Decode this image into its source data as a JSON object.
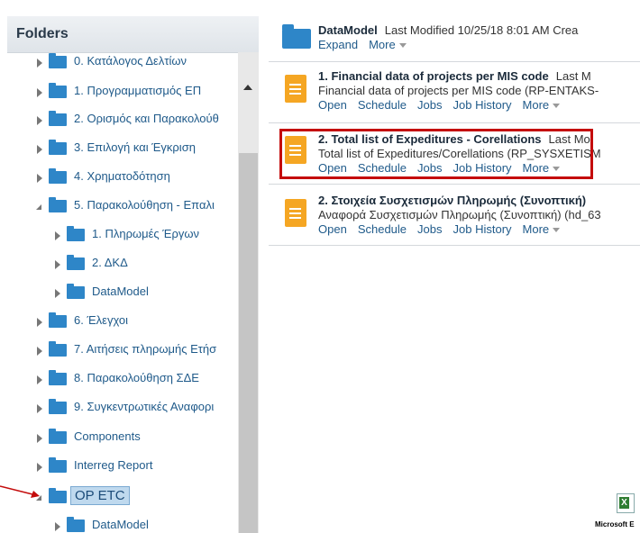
{
  "sidebar": {
    "header": "Folders",
    "items": [
      {
        "label": "0. Κατάλογος Δελτίων",
        "expanded": false
      },
      {
        "label": "1.  Προγραμματισμός ΕΠ",
        "expanded": false
      },
      {
        "label": "2. Ορισμός και Παρακολούθ",
        "expanded": false
      },
      {
        "label": "3. Επιλογή και Έγκριση",
        "expanded": false
      },
      {
        "label": "4. Χρηματοδότηση",
        "expanded": false
      },
      {
        "label": "5. Παρακολούθηση - Επαλι",
        "expanded": true
      },
      {
        "label": "1. Πληρωμές Έργων",
        "expanded": false
      },
      {
        "label": "2. ΔΚΔ",
        "expanded": false
      },
      {
        "label": "DataModel",
        "expanded": false
      },
      {
        "label": "6. Έλεγχοι",
        "expanded": false
      },
      {
        "label": "7. Αιτήσεις πληρωμής Ετήσ",
        "expanded": false
      },
      {
        "label": "8. Παρακολούθηση ΣΔΕ",
        "expanded": false
      },
      {
        "label": "9. Συγκεντρωτικές Αναφορι",
        "expanded": false
      },
      {
        "label": "Components",
        "expanded": false
      },
      {
        "label": "Interreg Report",
        "expanded": false
      },
      {
        "label": "OP ETC",
        "expanded": true
      },
      {
        "label": "DataModel",
        "expanded": false
      }
    ]
  },
  "main": {
    "folder_item": {
      "title": "DataModel",
      "meta": "Last Modified 10/25/18 8:01 AM   Crea",
      "actions": [
        "Expand",
        "More"
      ]
    },
    "items": [
      {
        "title": "1. Financial data of projects per MIS code",
        "meta": "Last M",
        "desc": "Financial data of projects per MIS code (RP-ENTAKS-",
        "actions": [
          "Open",
          "Schedule",
          "Jobs",
          "Job History",
          "More"
        ]
      },
      {
        "title": "2. Total list of Expeditures - Corellations",
        "meta": "Last Mo",
        "desc": "Total list of Expeditures/Corellations (RP_SYSXETISM",
        "actions": [
          "Open",
          "Schedule",
          "Jobs",
          "Job History",
          "More"
        ]
      },
      {
        "title": "2. Στοιχεία Συσχετισμών Πληρωμής (Συνοπτική)",
        "meta": "",
        "desc": "Αναφορά Συσχετισμών Πληρωμής (Συνοπτική) (hd_63",
        "actions": [
          "Open",
          "Schedule",
          "Jobs",
          "Job History",
          "More"
        ]
      }
    ]
  },
  "desktop": {
    "excel_label": "Microsoft E"
  },
  "colors": {
    "folder": "#2e86c8",
    "report_icon": "#f5a623",
    "highlight": "#c40c0c",
    "link": "#1f5a8a"
  }
}
